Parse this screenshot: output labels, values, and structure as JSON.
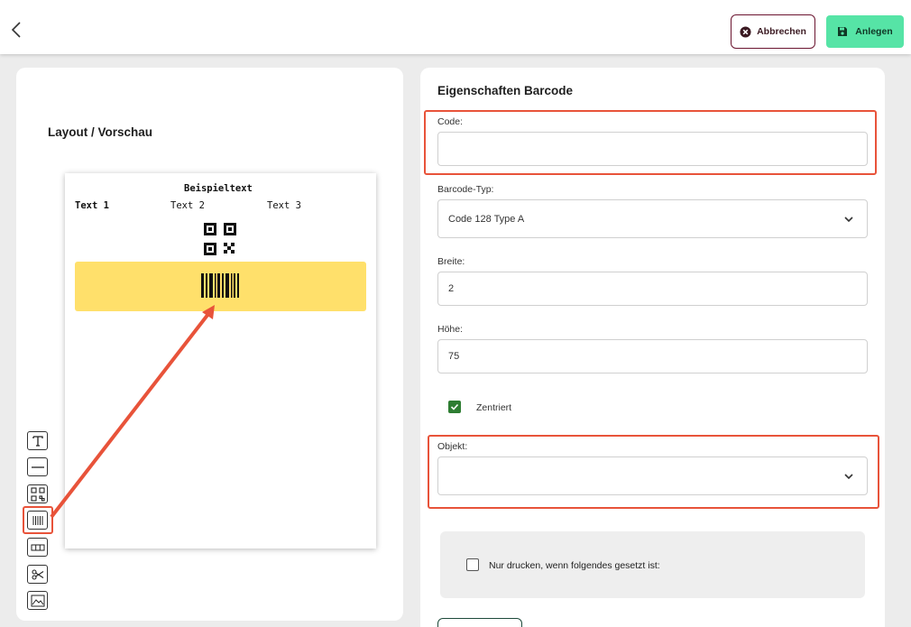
{
  "header": {
    "cancel_label": "Abbrechen",
    "save_label": "Anlegen"
  },
  "preview": {
    "title": "Layout / Vorschau",
    "sample_heading": "Beispieltext",
    "text1": "Text 1",
    "text2": "Text 2",
    "text3": "Text 3",
    "highlight_color": "#ffe06b"
  },
  "tools": [
    "text-tool-icon",
    "line-tool-icon",
    "qrcode-tool-icon",
    "barcode-tool-icon",
    "table-tool-icon",
    "scissors-tool-icon",
    "image-tool-icon"
  ],
  "properties": {
    "title": "Eigenschaften Barcode",
    "code_label": "Code:",
    "code_value": "",
    "type_label": "Barcode-Typ:",
    "type_value": "Code 128 Type A",
    "width_label": "Breite:",
    "width_value": "2",
    "height_label": "Höhe:",
    "height_value": "75",
    "centered_label": "Zentriert",
    "centered_checked": true,
    "object_label": "Objekt:",
    "object_value": "",
    "print_condition_label": "Nur drucken, wenn folgendes gesetzt ist:",
    "print_condition_checked": false
  },
  "colors": {
    "accent_save": "#56e4a6",
    "cancel_border": "#6b1530",
    "annotation_red": "#e8533a",
    "checkbox_green": "#2e7d32"
  }
}
